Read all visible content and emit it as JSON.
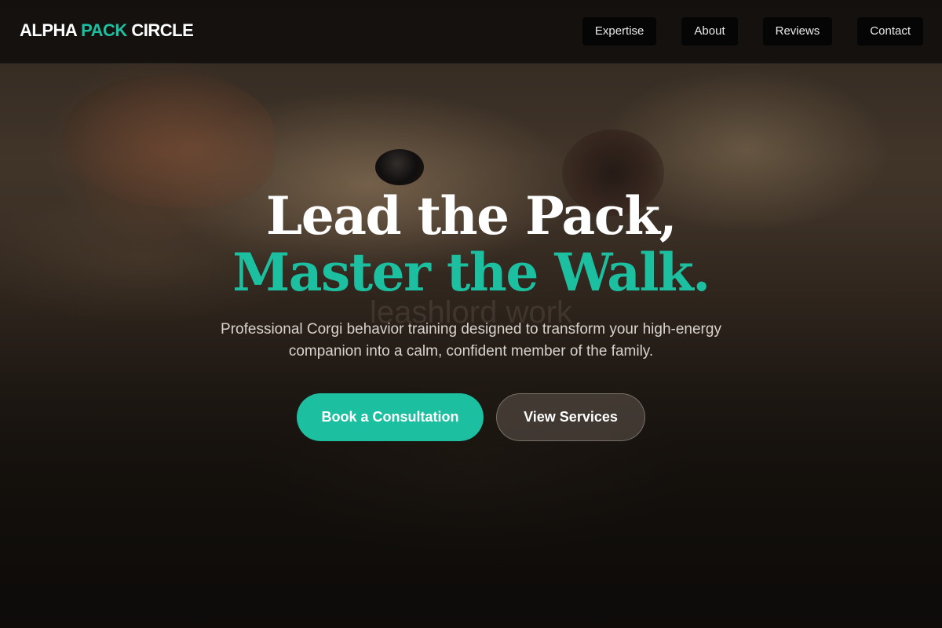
{
  "brand": {
    "name_part1": "ALPHA ",
    "name_accent": "PACK",
    "name_part2": " CIRCLE",
    "accent_color": "#1cbf9f"
  },
  "nav": {
    "items": [
      {
        "label": "Expertise"
      },
      {
        "label": "About"
      },
      {
        "label": "Reviews"
      },
      {
        "label": "Contact"
      }
    ]
  },
  "hero": {
    "headline_line1": "Lead the Pack,",
    "headline_line2": "Master the Walk.",
    "ghost_text": "leashlord work",
    "subtitle": "Professional Corgi behavior training designed to transform your high-energy companion into a calm, confident member of the family.",
    "primary_cta": "Book a Consultation",
    "secondary_cta": "View Services"
  },
  "colors": {
    "accent": "#1cbf9f",
    "header_bg": "#100e0c",
    "nav_button_bg": "#050505"
  }
}
